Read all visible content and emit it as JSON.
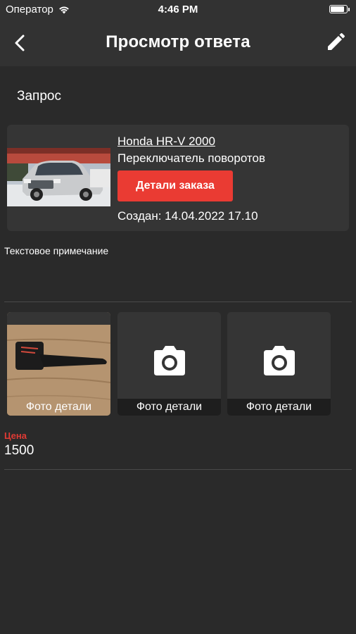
{
  "status_bar": {
    "carrier": "Оператор",
    "time": "4:46 PM",
    "battery_level": 0.95
  },
  "nav": {
    "title": "Просмотр ответа"
  },
  "section_label": "Запрос",
  "request": {
    "car_model": "Honda HR-V 2000",
    "part_name": "Переключатель поворотов",
    "order_button_label": "Детали заказа",
    "created": "Создан: 14.04.2022 17.10"
  },
  "note_label": "Текстовое примечание",
  "photos": [
    {
      "caption": "Фото детали"
    },
    {
      "caption": "Фото детали"
    },
    {
      "caption": "Фото детали"
    }
  ],
  "price": {
    "label": "Цена",
    "value": "1500"
  },
  "colors": {
    "accent": "#ea3b33",
    "background": "#2a2a2a",
    "bar": "#323232",
    "card": "#353535"
  }
}
